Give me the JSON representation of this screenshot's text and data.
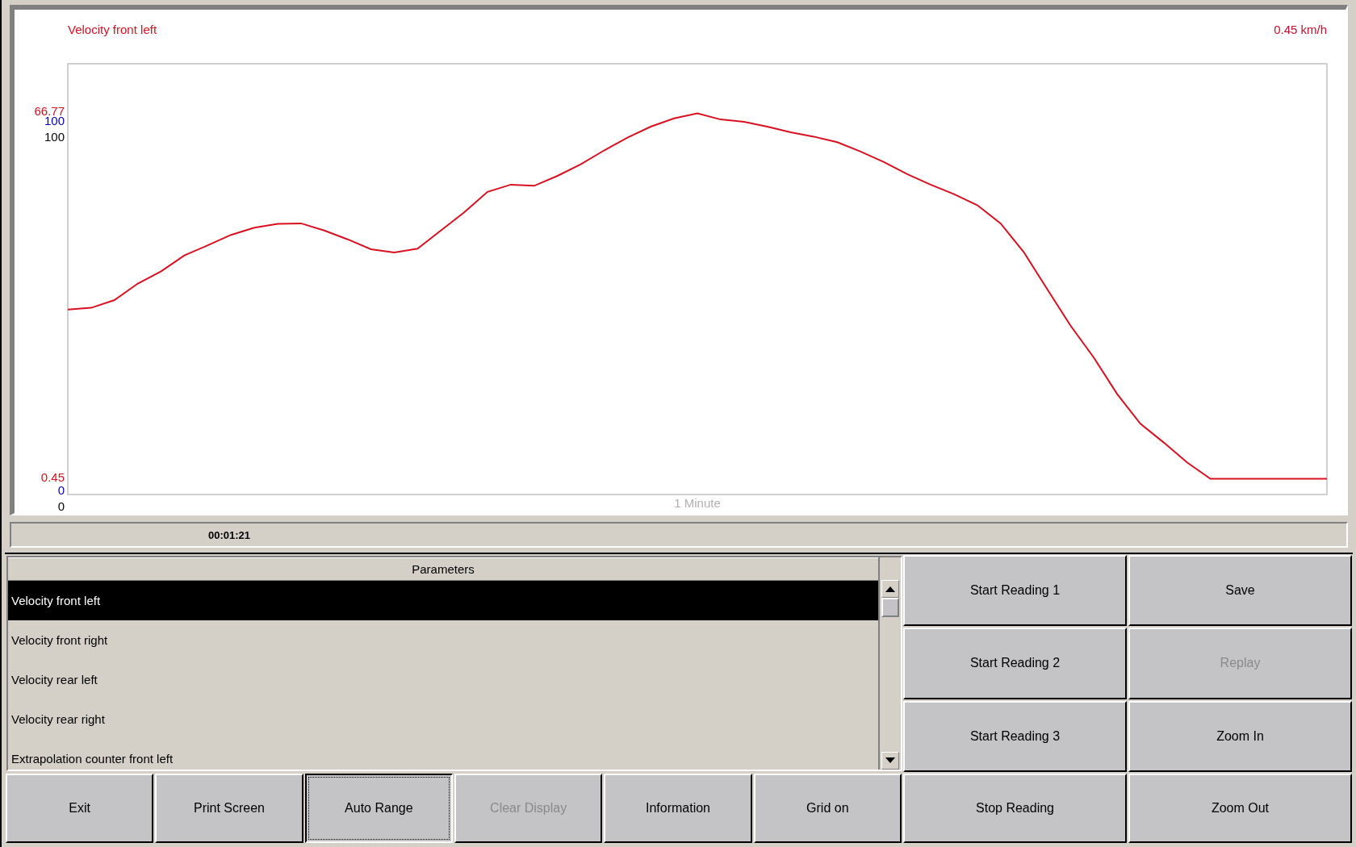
{
  "chart": {
    "reading": "0.45 km/h",
    "other_scales": [
      {
        "color": "#0000c0",
        "max": "100",
        "min": "0"
      },
      {
        "color": "#000000",
        "max": "100",
        "min": "0"
      }
    ],
    "chart_data": {
      "type": "line",
      "xlabel": "1 Minute",
      "ylim": [
        -2.4,
        75.6
      ],
      "yticks": [
        0.45,
        66.77
      ],
      "categories": [
        null,
        null,
        null,
        null,
        null,
        null,
        null,
        null,
        null,
        null,
        null,
        null,
        null,
        null,
        null,
        null,
        null,
        null,
        null,
        null,
        null,
        null,
        null,
        null,
        null,
        null,
        null,
        null,
        null,
        null,
        null,
        null,
        null,
        null,
        null,
        null,
        null,
        null,
        null,
        null,
        null,
        null,
        null,
        null,
        null,
        null,
        null,
        null,
        null,
        null,
        null,
        null,
        null,
        null,
        null
      ],
      "series": [
        {
          "name": "Velocity front left",
          "color": "#d81020",
          "values": [
            31.1,
            31.4,
            32.8,
            35.8,
            38.0,
            40.9,
            42.7,
            44.6,
            45.9,
            46.6,
            46.7,
            45.4,
            43.8,
            42.0,
            41.4,
            42.1,
            45.4,
            48.7,
            52.4,
            53.7,
            53.5,
            55.3,
            57.4,
            59.9,
            62.2,
            64.2,
            65.7,
            66.6,
            65.5,
            65.1,
            64.2,
            63.2,
            62.4,
            61.4,
            59.7,
            57.8,
            55.6,
            53.7,
            52.0,
            50.0,
            46.7,
            41.5,
            34.8,
            28.2,
            22.4,
            15.8,
            10.4,
            7.0,
            3.4,
            0.45,
            0.45,
            0.45,
            0.45,
            0.45,
            0.45
          ]
        }
      ]
    }
  },
  "timer": "00:01:21",
  "parameters": {
    "header": "Parameters",
    "items": [
      {
        "label": "Velocity front left",
        "selected": true
      },
      {
        "label": "Velocity front right",
        "selected": false
      },
      {
        "label": "Velocity rear left",
        "selected": false
      },
      {
        "label": "Velocity rear right",
        "selected": false
      },
      {
        "label": "Extrapolation counter front left",
        "selected": false
      }
    ]
  },
  "side_buttons": [
    {
      "label": "Start Reading 1",
      "disabled": false
    },
    {
      "label": "Save",
      "disabled": false
    },
    {
      "label": "Start Reading 2",
      "disabled": false
    },
    {
      "label": "Replay",
      "disabled": true
    },
    {
      "label": "Start Reading 3",
      "disabled": false
    },
    {
      "label": "Zoom In",
      "disabled": false
    }
  ],
  "bottom_buttons": [
    {
      "label": "Exit",
      "disabled": false,
      "focused": false
    },
    {
      "label": "Print Screen",
      "disabled": false,
      "focused": false
    },
    {
      "label": "Auto Range",
      "disabled": false,
      "focused": true
    },
    {
      "label": "Clear Display",
      "disabled": true,
      "focused": false
    },
    {
      "label": "Information",
      "disabled": false,
      "focused": false
    },
    {
      "label": "Grid on",
      "disabled": false,
      "focused": false
    },
    {
      "label": "Stop Reading",
      "disabled": false,
      "focused": false
    },
    {
      "label": "Zoom Out",
      "disabled": false,
      "focused": false
    }
  ]
}
